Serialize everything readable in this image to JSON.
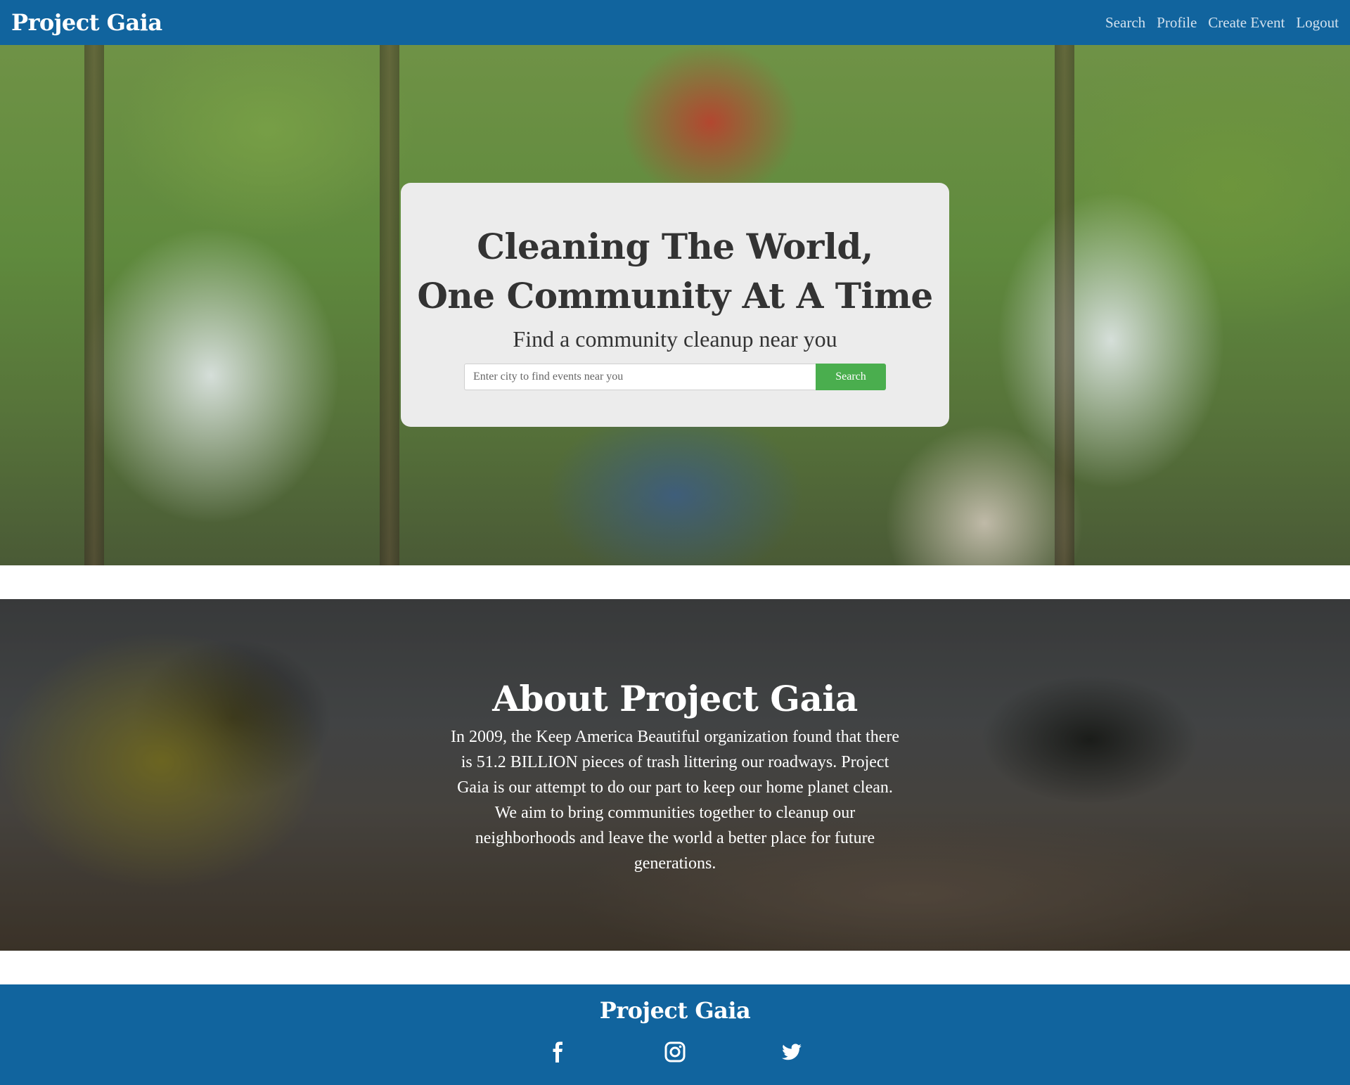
{
  "navbar": {
    "brand": "Project Gaia",
    "links": [
      {
        "label": "Search"
      },
      {
        "label": "Profile"
      },
      {
        "label": "Create Event"
      },
      {
        "label": "Logout"
      }
    ]
  },
  "hero": {
    "title_line1": "Cleaning The World,",
    "title_line2": "One Community At A Time",
    "subtitle": "Find a community cleanup near you",
    "search": {
      "placeholder": "Enter city to find events near you",
      "value": "",
      "button_label": "Search"
    }
  },
  "about": {
    "title": "About Project Gaia",
    "text": "In 2009, the Keep America Beautiful organization found that there is 51.2 BILLION pieces of trash littering our roadways. Project Gaia is our attempt to do our part to keep our home planet clean. We aim to bring communities together to cleanup our neighborhoods and leave the world a better place for future generations."
  },
  "footer": {
    "brand": "Project Gaia",
    "social": [
      "facebook-icon",
      "instagram-icon",
      "twitter-icon"
    ]
  },
  "colors": {
    "brand_blue": "#11649e",
    "search_green": "#4aae4e",
    "card_bg": "#ececec"
  }
}
